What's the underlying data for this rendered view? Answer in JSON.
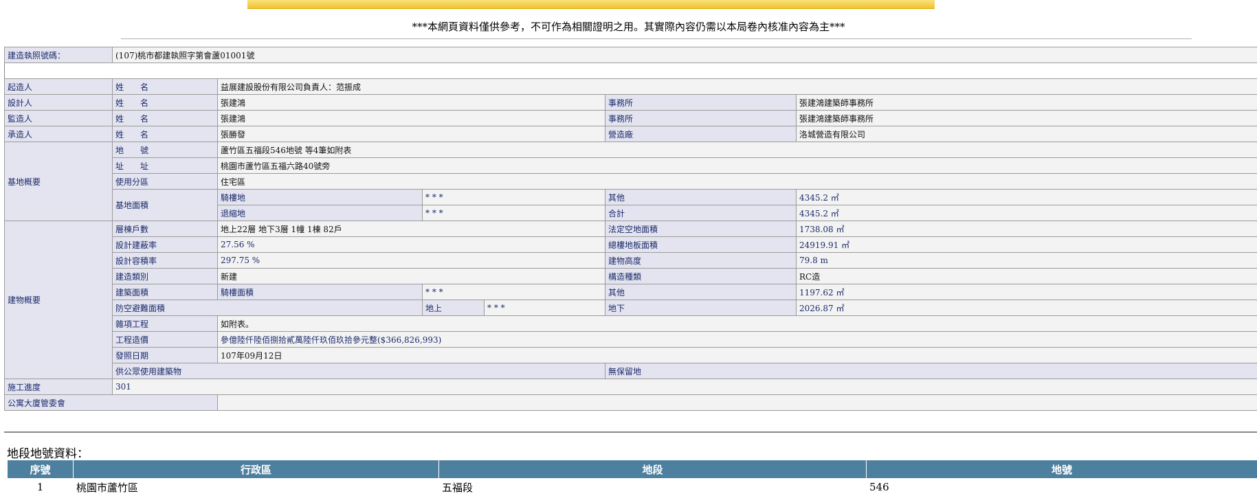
{
  "header": {
    "notice": "***本網頁資料僅供參考，不可作為相關證明之用。其實際內容仍需以本局卷內核准內容為主***"
  },
  "permit": {
    "number_label": "建造執照號碼：",
    "number": "(107)桃市都建執照字第會蘆01001號",
    "builder_label": "起造人",
    "designer_label": "設計人",
    "supervisor_label": "監造人",
    "contractor_label": "承造人",
    "name_label": "姓　　名",
    "office_label": "事務所",
    "firm_label": "營造廠",
    "builder_name": "益展建設股份有限公司負責人：范振成",
    "designer_name": "張建鴻",
    "designer_office": "張建鴻建築師事務所",
    "supervisor_name": "張建鴻",
    "supervisor_office": "張建鴻建築師事務所",
    "contractor_name": "張勝發",
    "contractor_firm": "洛城營造有限公司"
  },
  "site": {
    "section_label": "基地概要",
    "lot_label": "地　　號",
    "lot": "蘆竹區五福段546地號 等4筆如附表",
    "address_label": "址　　址",
    "address": "桃園市蘆竹區五福六路40號旁",
    "zoning_label": "使用分區",
    "zoning": "住宅區",
    "area_label": "基地面積",
    "arcade_label": "騎樓地",
    "arcade": "* * *",
    "setback_label": "退縮地",
    "setback": "* * *",
    "other_label": "其他",
    "other": "4345.2 ㎡",
    "total_label": "合計",
    "total": "4345.2 ㎡"
  },
  "building": {
    "section_label": "建物概要",
    "floors_label": "層棟戶數",
    "floors": "地上22層 地下3層 1幢 1棟 82戶",
    "open_space_label": "法定空地面積",
    "open_space": "1738.08 ㎡",
    "coverage_label": "設計建蔽率",
    "coverage": "27.56 %",
    "floor_area_label": "總樓地板面積",
    "floor_area": "24919.91 ㎡",
    "far_label": "設計容積率",
    "far": "297.75 %",
    "height_label": "建物高度",
    "height": "79.8 m",
    "type_label": "建造類別",
    "type": "新建",
    "structure_label": "構造種類",
    "structure": "RC造",
    "bld_area_label": "建築面積",
    "arcade_area_label": "騎樓面積",
    "arcade_area": "* * *",
    "bld_other_label": "其他",
    "bld_other": "1197.62 ㎡",
    "shelter_label": "防空避難面積",
    "above_label": "地上",
    "above": "* * *",
    "below_label": "地下",
    "below": "2026.87 ㎡",
    "misc_label": "雜項工程",
    "misc": "如附表。",
    "cost_label": "工程造價",
    "cost": "參億陸仟陸佰捌拾貳萬陸仟玖佰玖拾參元整($366,826,993)",
    "issue_label": "發照日期",
    "issue": "107年09月12日",
    "public_label": "供公眾使用建築物",
    "reserve_label": "無保留地"
  },
  "progress": {
    "label": "施工進度",
    "value": "301"
  },
  "committee": {
    "label": "公寓大廈管委會"
  },
  "lots": {
    "title": "地段地號資料：",
    "headers": [
      "序號",
      "行政區",
      "地段",
      "地號"
    ],
    "rows": [
      [
        "1",
        "桃園市蘆竹區",
        "五福段",
        "546"
      ]
    ]
  }
}
